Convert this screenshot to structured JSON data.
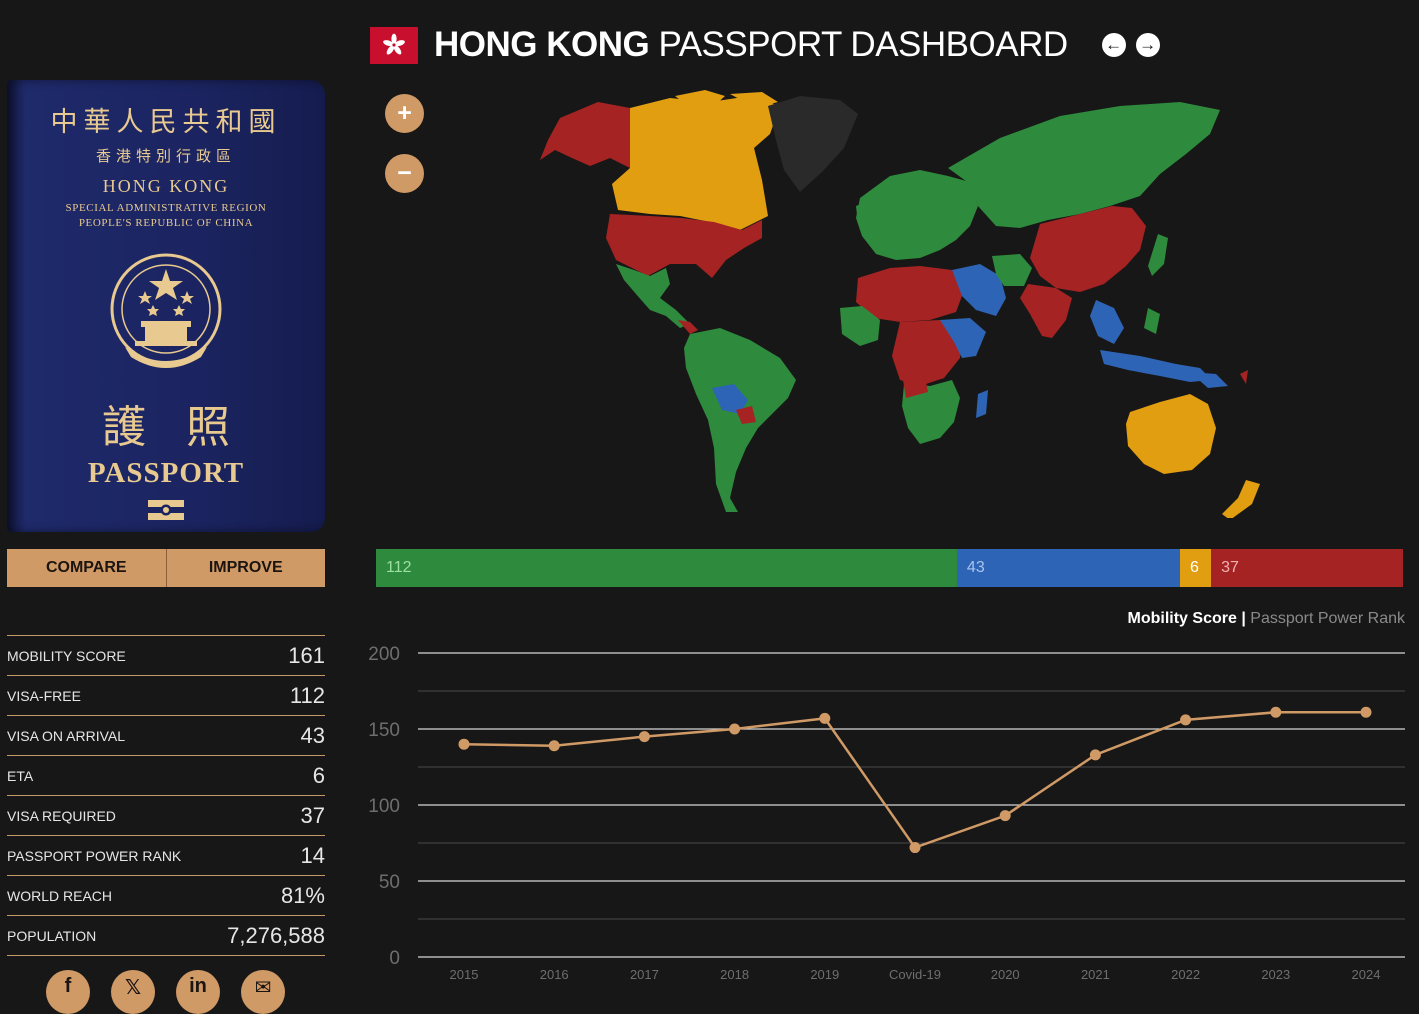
{
  "header": {
    "title_bold": "HONG KONG",
    "title_rest": "PASSPORT DASHBOARD"
  },
  "passport": {
    "line_cn_1": "中華人民共和國",
    "line_cn_2": "香港特別行政區",
    "line_en_1": "HONG KONG",
    "line_en_2": "SPECIAL ADMINISTRATIVE REGION",
    "line_en_3": "PEOPLE'S REPUBLIC OF CHINA",
    "line_cn_3": "護照",
    "line_en_4": "PASSPORT"
  },
  "buttons": {
    "compare": "COMPARE",
    "improve": "IMPROVE"
  },
  "stats": [
    {
      "label": "MOBILITY SCORE",
      "value": "161"
    },
    {
      "label": "VISA-FREE",
      "value": "112"
    },
    {
      "label": "VISA ON ARRIVAL",
      "value": "43"
    },
    {
      "label": "ETA",
      "value": "6"
    },
    {
      "label": "VISA REQUIRED",
      "value": "37"
    },
    {
      "label": "PASSPORT POWER RANK",
      "value": "14"
    },
    {
      "label": "WORLD REACH",
      "value": "81%"
    },
    {
      "label": "POPULATION",
      "value": "7,276,588"
    }
  ],
  "socials": [
    "facebook-icon",
    "x-icon",
    "linkedin-icon",
    "email-icon"
  ],
  "zoom": {
    "in_label": "+",
    "out_label": "−"
  },
  "breakdown": [
    {
      "value": 112,
      "label": "112",
      "color": "#2e8a3c",
      "text_color": "#9de0a0"
    },
    {
      "value": 43,
      "label": "43",
      "color": "#2e64b6",
      "text_color": "#a8c4ee"
    },
    {
      "value": 6,
      "label": "6",
      "color": "#e19e10",
      "text_color": "#ffffff"
    },
    {
      "value": 37,
      "label": "37",
      "color": "#a52323",
      "text_color": "#f0b0b0"
    }
  ],
  "legend": {
    "active": "Mobility Score",
    "separator": "|",
    "inactive": "Passport Power Rank"
  },
  "colors": {
    "visa_free": "#2e8a3c",
    "visa_on_arrival": "#2e64b6",
    "eta": "#e19e10",
    "visa_required": "#a52323",
    "accent": "#d09a66",
    "background": "#181717",
    "home_country": "#222222"
  },
  "chart_data": {
    "type": "line",
    "categories": [
      "2015",
      "2016",
      "2017",
      "2018",
      "2019",
      "Covid-19",
      "2020",
      "2021",
      "2022",
      "2023",
      "2024"
    ],
    "series": [
      {
        "values": [
          140,
          139,
          145,
          150,
          157,
          72,
          93,
          133,
          156,
          161,
          161
        ]
      }
    ],
    "yticks": [
      0,
      50,
      100,
      150,
      200
    ],
    "ylim": [
      0,
      200
    ],
    "line_color": "#d09a66",
    "grid": true
  }
}
